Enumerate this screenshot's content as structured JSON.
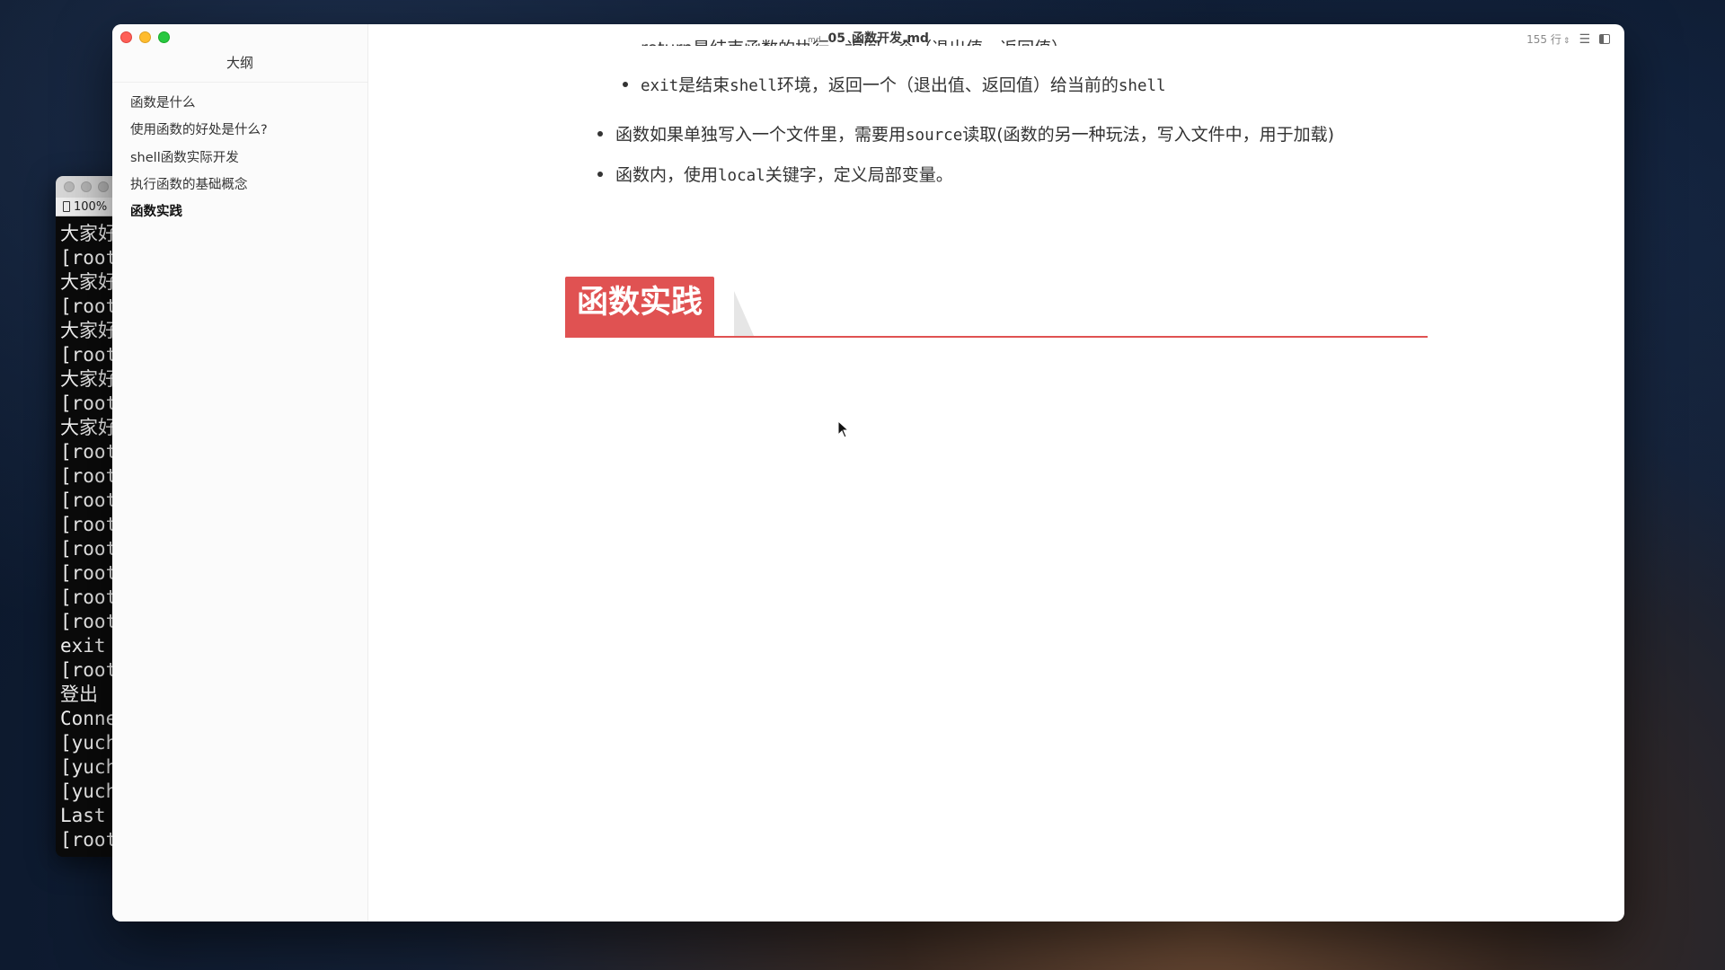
{
  "terminal": {
    "zoom": "100%",
    "lines": [
      "大家好",
      "[root",
      "大家好",
      "[root",
      "大家好",
      "[root",
      "大家好",
      "[root",
      "大家好",
      "[root",
      "[root",
      "[root",
      "[root",
      "[root",
      "[root",
      "[root",
      "[root",
      "exit",
      "[root",
      "登出",
      "Conne",
      "[yuch",
      "[yuch",
      "[yuch",
      "Last",
      "[root"
    ]
  },
  "window": {
    "title": "05_函数开发.md",
    "line_count": "155 行"
  },
  "sidebar": {
    "header": "大纲",
    "items": [
      {
        "label": "函数是什么"
      },
      {
        "label": "使用函数的好处是什么?"
      },
      {
        "label": "shell函数实际开发"
      },
      {
        "label": "执行函数的基础概念"
      },
      {
        "label": "函数实践"
      }
    ],
    "active_index": 4
  },
  "content": {
    "clipped_line": "return是结束函数的执行，返回一个（退出值、返回值）",
    "bullet_exit": {
      "pre": "exit",
      "mid": "是结束",
      "code": "shell",
      "post": "环境，返回一个（退出值、返回值）给当前的",
      "tail": "shell"
    },
    "bullet_source": {
      "pre": "函数如果单独写入一个文件里，需要用",
      "code": "source",
      "post": "读取(函数的另一种玩法，写入文件中，用于加载)"
    },
    "bullet_local": {
      "pre": "函数内，使用",
      "code": "local",
      "post": "关键字，定义局部变量。"
    },
    "heading": "函数实践"
  },
  "colors": {
    "accent_red": "#e05252",
    "close": "#fe5f57",
    "minimize": "#febc2e",
    "zoom": "#28c840"
  }
}
